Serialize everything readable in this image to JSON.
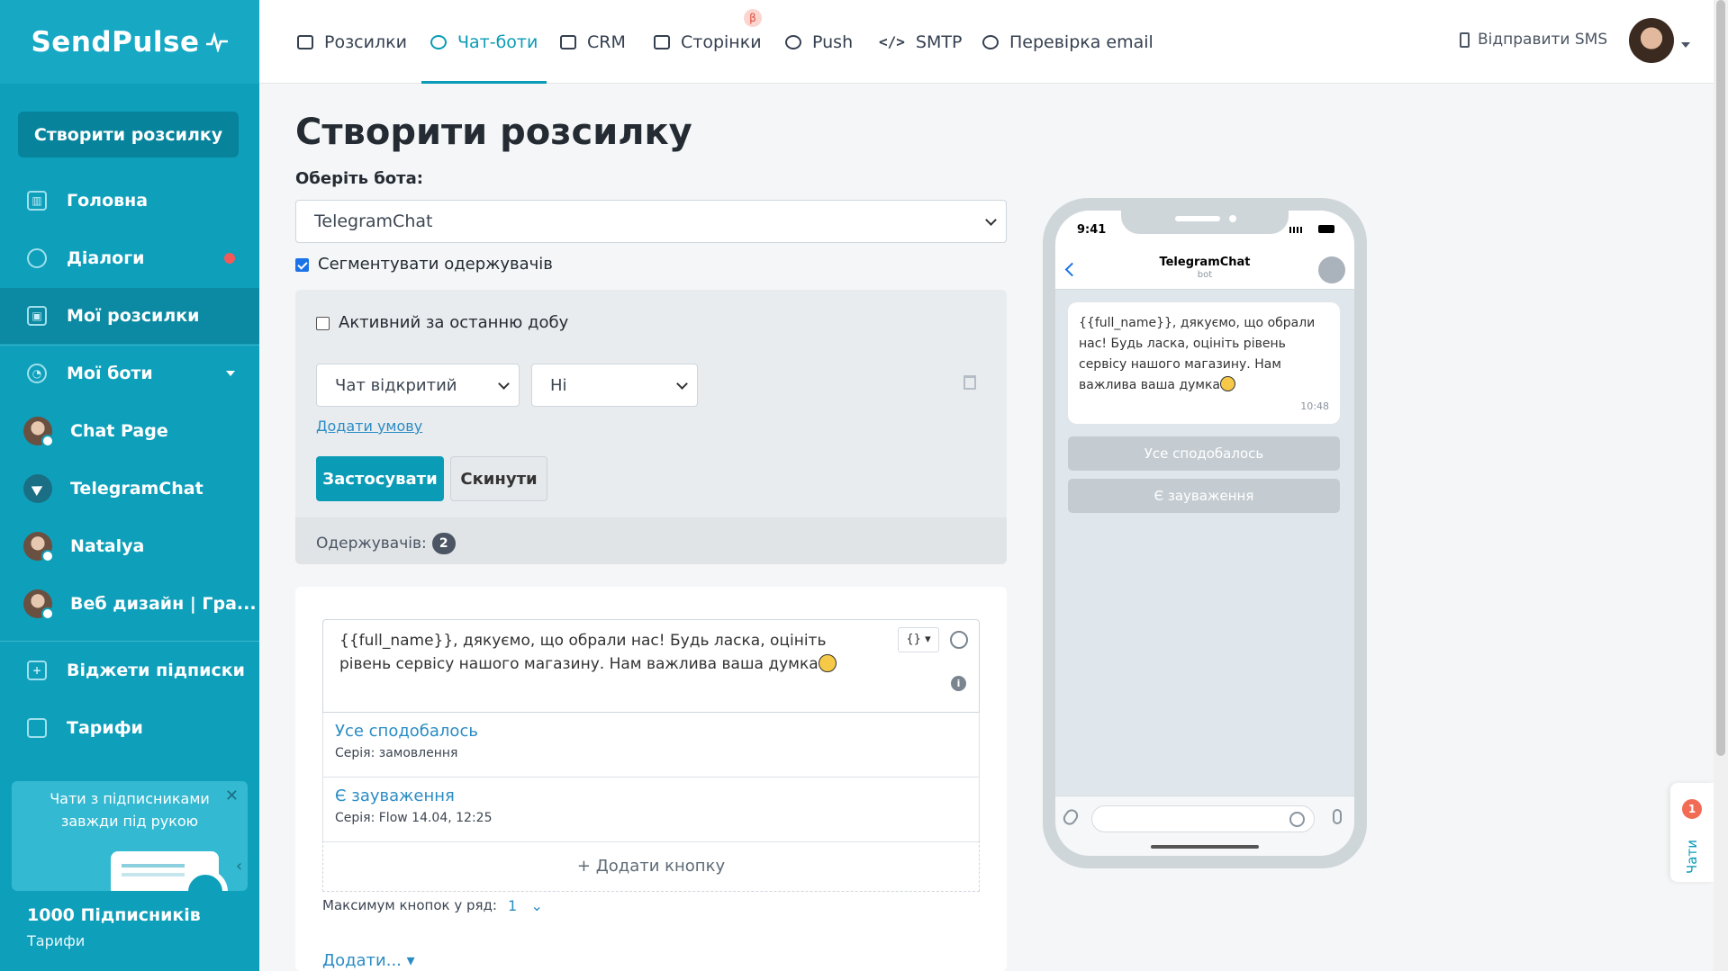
{
  "brand": {
    "logo": "SendPulse",
    "accent": "#0a9bb6",
    "sidebar_bg": "#0e9fbb"
  },
  "sidebar": {
    "create_button": "Створити розсилку",
    "items": [
      {
        "label": "Головна",
        "icon": "dashboard-icon"
      },
      {
        "label": "Діалоги",
        "icon": "chat-bubble-icon"
      },
      {
        "label": "Мої розсилки",
        "icon": "broadcast-icon"
      },
      {
        "label": "Мої боти",
        "icon": "bots-icon"
      }
    ],
    "bots": [
      {
        "label": "Chat Page"
      },
      {
        "label": "TelegramChat"
      },
      {
        "label": "Natalya"
      },
      {
        "label": "Веб дизайн | Гра..."
      }
    ],
    "extra": [
      {
        "label": "Віджети підписки",
        "icon": "widget-icon"
      },
      {
        "label": "Тарифи",
        "icon": "wallet-icon"
      }
    ],
    "promo": {
      "text": "Чати з підписниками завжди під рукою"
    },
    "subscribers": {
      "title": "1000 Підписників",
      "link": "Тарифи"
    }
  },
  "header": {
    "tabs": [
      {
        "label": "Розсилки"
      },
      {
        "label": "Чат-боти"
      },
      {
        "label": "CRM"
      },
      {
        "label": "Сторінки",
        "badge": "β"
      },
      {
        "label": "Push"
      },
      {
        "label": "SMTP"
      },
      {
        "label": "Перевірка email"
      }
    ],
    "sms_link": "Відправити SMS"
  },
  "main": {
    "title": "Створити розсилку",
    "bot_label": "Оберіть бота:",
    "bot_selected": "TelegramChat",
    "segment_label": "Сегментувати одержувачів",
    "filter": {
      "active_label": "Активний за останню добу",
      "condition_field": "Чат відкритий",
      "condition_value": "Ні",
      "add_condition": "Додати умову",
      "apply": "Застосувати",
      "reset": "Скинути",
      "recipients_label": "Одержувачів:",
      "recipients_count": "2"
    },
    "editor": {
      "text": "{{full_name}}, дякуємо, що обрали нас! Будь ласка, оцініть рівень сервісу нашого магазину. Нам важлива ваша думка",
      "var_button": "{}",
      "buttons": [
        {
          "title": "Усе сподобалось",
          "sub": "Серія: замовлення"
        },
        {
          "title": "Є зауваження",
          "sub": "Серія: Flow 14.04, 12:25"
        }
      ],
      "add_button": "+ Додати кнопку",
      "max_label": "Максимум кнопок у ряд:",
      "max_value": "1",
      "add_more": "Додати..."
    }
  },
  "preview": {
    "time": "9:41",
    "chat_name": "TelegramChat",
    "chat_sub": "bot",
    "message": "{{full_name}}, дякуємо, що обрали нас! Будь ласка, оцініть рівень сервісу нашого магазину. Нам важлива ваша думка",
    "message_time": "10:48",
    "buttons": [
      "Усе сподобалось",
      "Є зауваження"
    ]
  },
  "chats_widget": {
    "count": "1",
    "label": "Чати"
  }
}
